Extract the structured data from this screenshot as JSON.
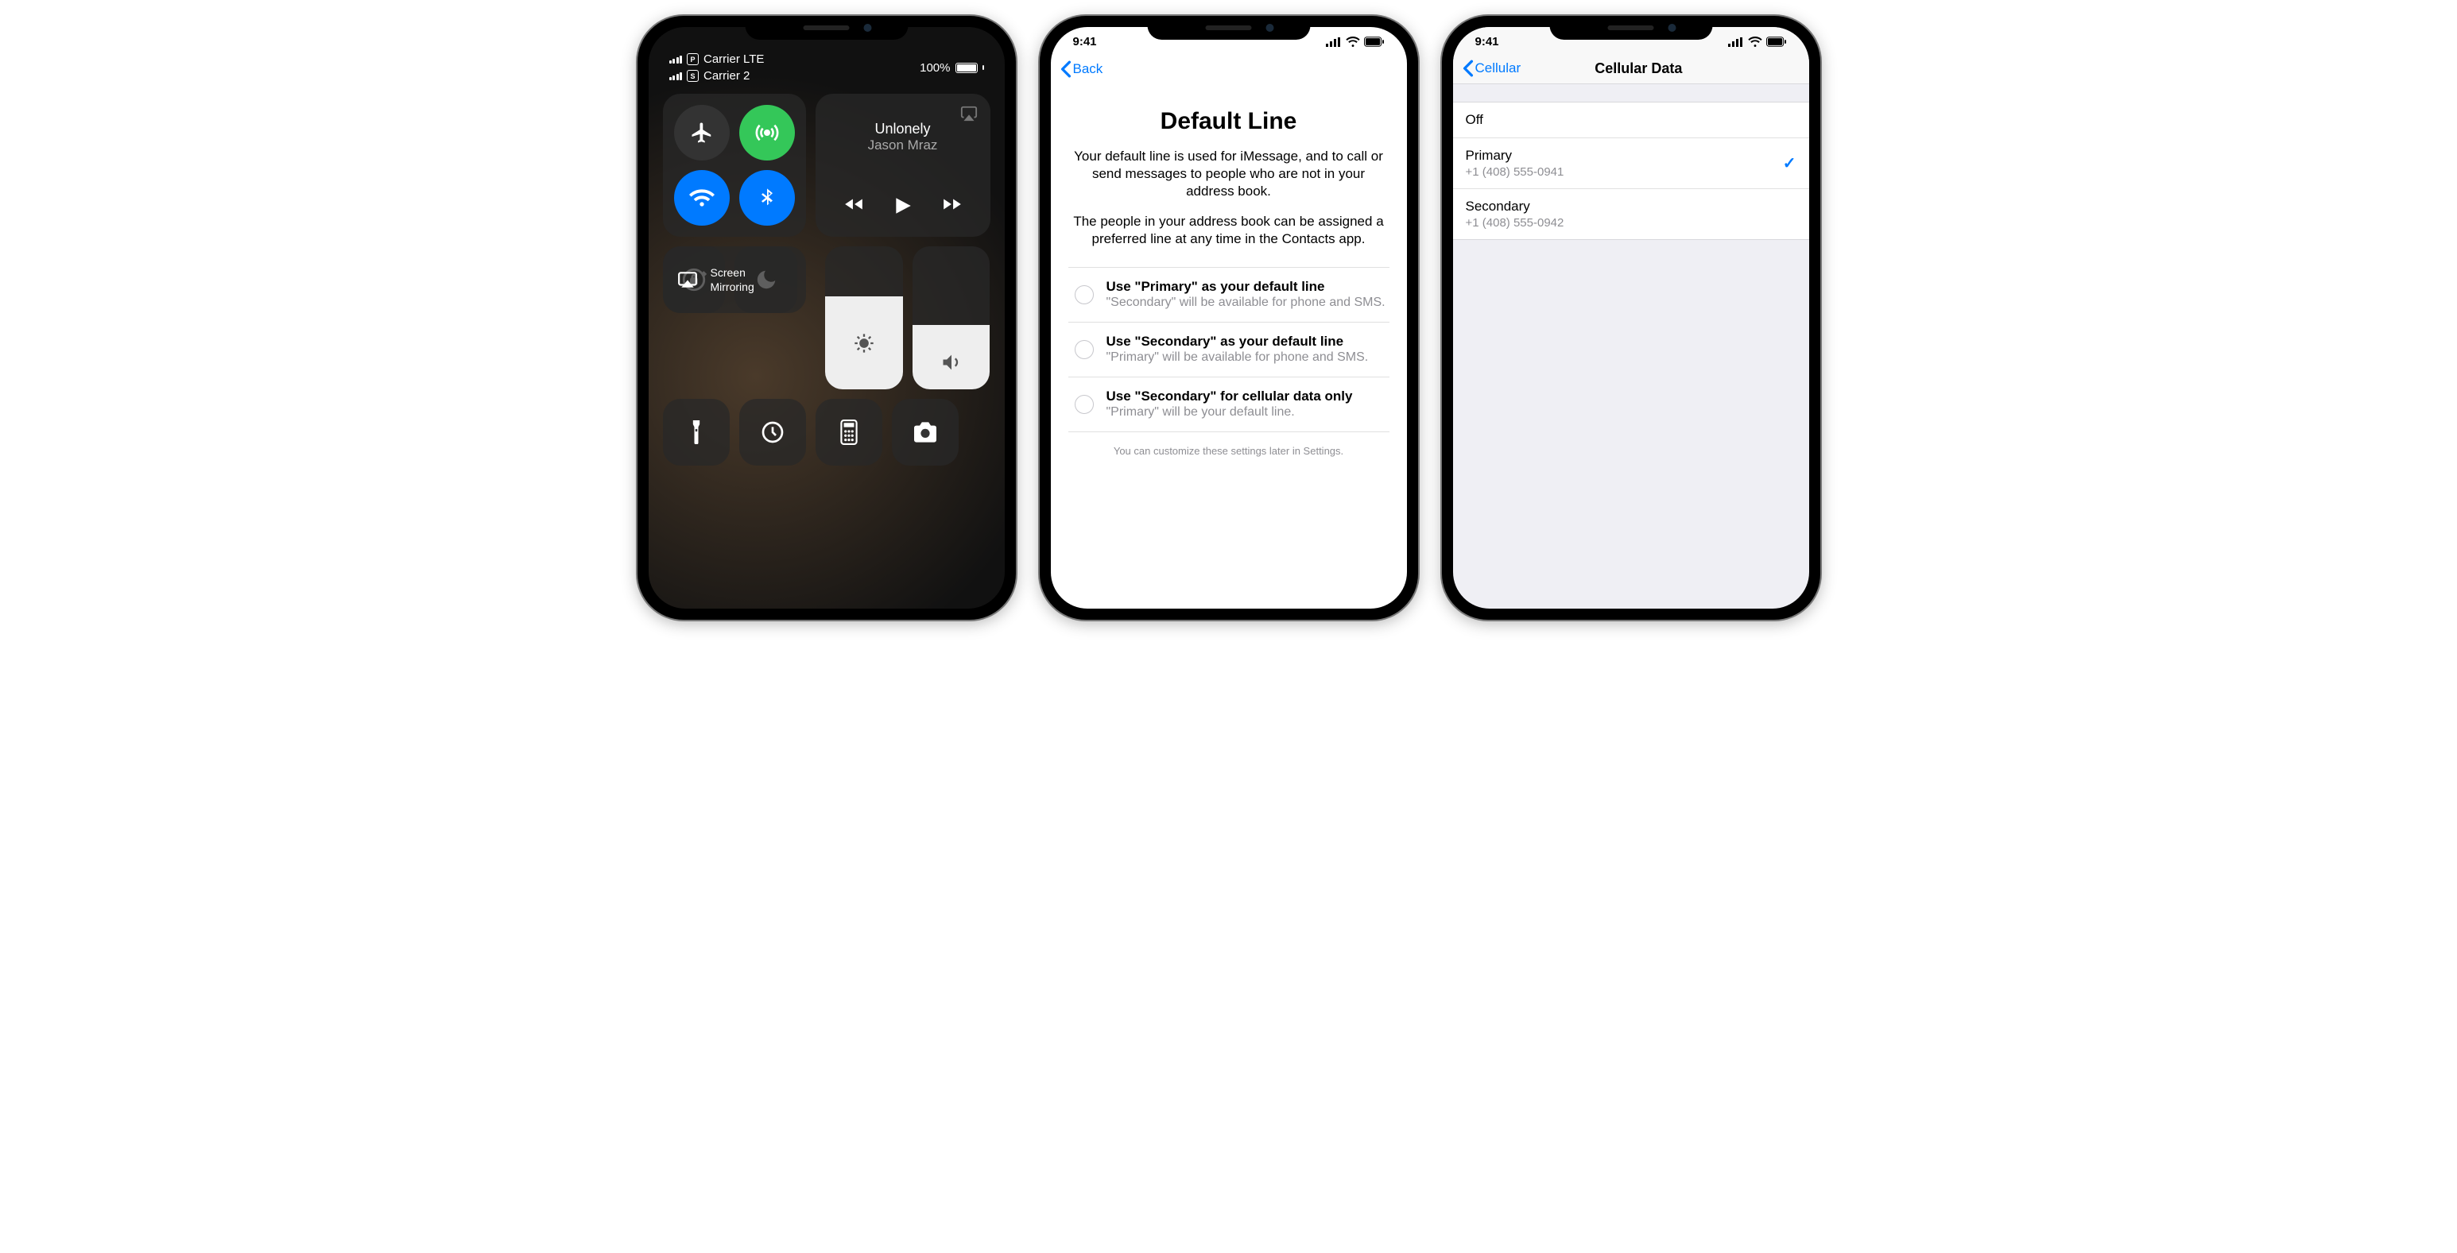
{
  "phone1": {
    "status": {
      "carrier1_sim": "P",
      "carrier1_label": "Carrier  LTE",
      "carrier2_sim": "S",
      "carrier2_label": "Carrier 2",
      "battery_pct": "100%"
    },
    "media": {
      "song": "Unlonely",
      "artist": "Jason Mraz"
    },
    "screen_mirroring": "Screen\nMirroring"
  },
  "phone2": {
    "status_time": "9:41",
    "nav_back": "Back",
    "title": "Default Line",
    "para1": "Your default line is used for iMessage, and to call or send messages to people who are not in your address book.",
    "para2": "The people in your address book can be assigned a preferred line at any time in the Contacts app.",
    "options": [
      {
        "t1": "Use \"Primary\" as your default line",
        "t2": "\"Secondary\" will be available for phone and SMS."
      },
      {
        "t1": "Use \"Secondary\" as your default line",
        "t2": "\"Primary\" will be available for phone and SMS."
      },
      {
        "t1": "Use \"Secondary\" for cellular data only",
        "t2": "\"Primary\" will be your default line."
      }
    ],
    "footer": "You can customize these settings later in Settings."
  },
  "phone3": {
    "status_time": "9:41",
    "nav_back": "Cellular",
    "title": "Cellular Data",
    "options": [
      {
        "label": "Off",
        "sub": "",
        "checked": false
      },
      {
        "label": "Primary",
        "sub": "+1 (408) 555-0941",
        "checked": true
      },
      {
        "label": "Secondary",
        "sub": "+1 (408) 555-0942",
        "checked": false
      }
    ]
  }
}
